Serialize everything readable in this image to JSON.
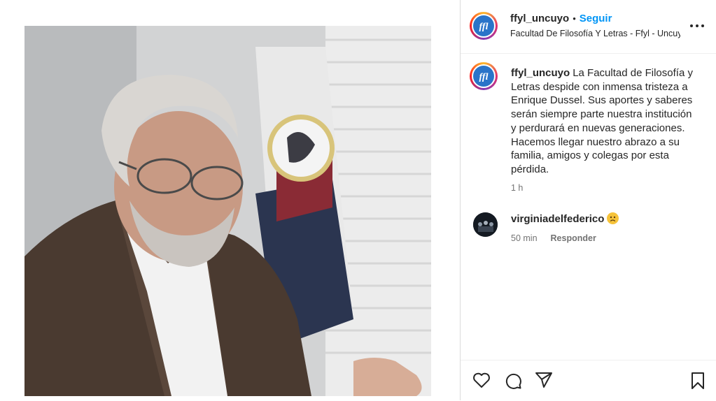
{
  "post": {
    "author": "ffyl_uncuyo",
    "follow_label": "Seguir",
    "separator": "•",
    "location": "Facultad De Filosofía Y Letras - Ffyl - Uncuyo",
    "caption_username": "ffyl_uncuyo",
    "caption_text": "La Facultad de Filosofía y Letras despide con inmensa tristeza a Enrique Dussel. Sus aportes y saberes serán siempre parte nuestra institución y perdurará en nuevas generaciones. Hacemos llegar nuestro abrazo a su familia, amigos y colegas por esta pérdida.",
    "caption_time": "1 h"
  },
  "comment": {
    "username": "virginiadelfederico",
    "emoji": "sad-face-emoji",
    "time": "50 min",
    "reply_label": "Responder"
  },
  "icons": {
    "like": "heart-icon",
    "comment": "comment-icon",
    "share": "send-icon",
    "save": "bookmark-icon",
    "more": "more-options-icon"
  },
  "colors": {
    "follow": "#0095f6",
    "text": "#262626",
    "muted": "#737373",
    "avatar_logo": "#2a74c9"
  }
}
